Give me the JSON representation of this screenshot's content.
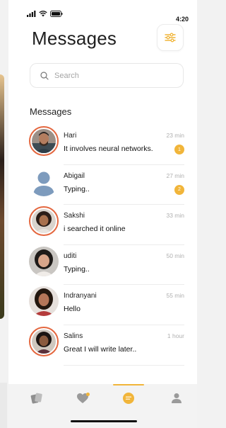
{
  "status": {
    "time": "4:20"
  },
  "header": {
    "title": "Messages"
  },
  "search": {
    "placeholder": "Search",
    "value": ""
  },
  "section_title": "Messages",
  "colors": {
    "accent": "#f1b53a",
    "ring": "#e4673f",
    "muted": "#b0b0b0"
  },
  "conversations": [
    {
      "name": "Hari",
      "message": "It involves neural networks.",
      "time": "23 min",
      "unread": "1"
    },
    {
      "name": "Abigail",
      "message": "Typing..",
      "time": "27 min",
      "unread": "2"
    },
    {
      "name": "Sakshi",
      "message": "i searched it online",
      "time": "33 min",
      "unread": ""
    },
    {
      "name": "uditi",
      "message": "Typing..",
      "time": "50 min",
      "unread": ""
    },
    {
      "name": "Indranyani",
      "message": " Hello",
      "time": "55 min",
      "unread": ""
    },
    {
      "name": "Salins",
      "message": "Great I will write later..",
      "time": "1 hour",
      "unread": ""
    }
  ],
  "tabs": [
    {
      "icon": "cards-icon"
    },
    {
      "icon": "heart-icon"
    },
    {
      "icon": "chat-icon",
      "active": true
    },
    {
      "icon": "profile-icon"
    }
  ]
}
